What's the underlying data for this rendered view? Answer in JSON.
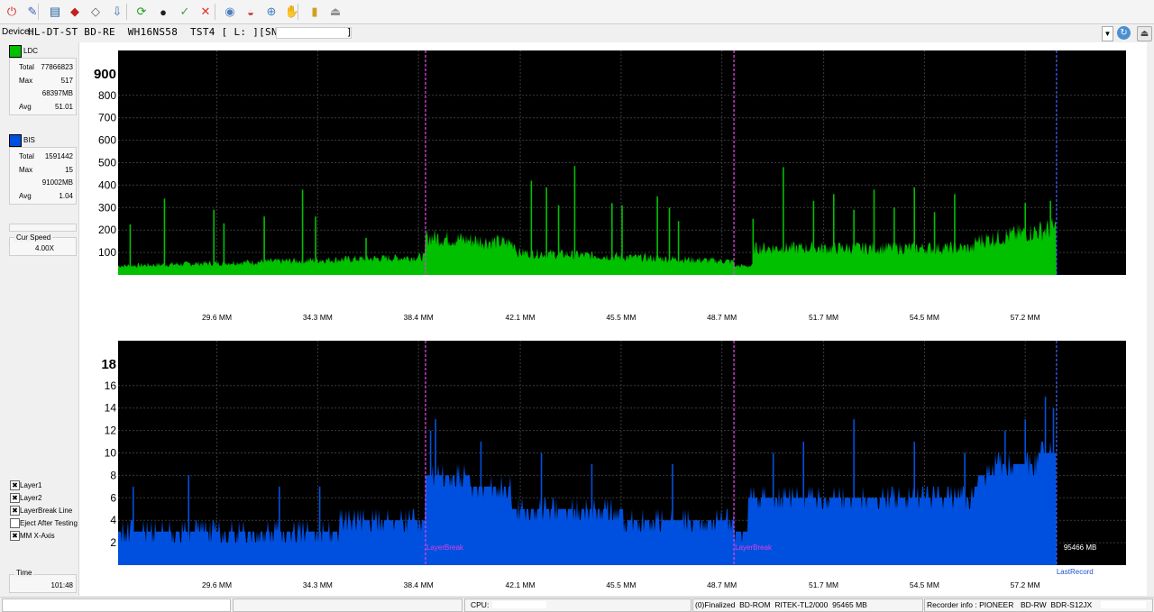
{
  "toolbar": {
    "buttons": [
      {
        "name": "power-icon",
        "glyph": "⏻",
        "color": "#d32020"
      },
      {
        "name": "disc-info-icon",
        "glyph": "✎",
        "color": "#4060c0"
      },
      {
        "name": "drive-icon",
        "glyph": "▤",
        "color": "#2060a0"
      },
      {
        "name": "erase-icon",
        "glyph": "◆",
        "color": "#c02020"
      },
      {
        "name": "burn-icon",
        "glyph": "◇",
        "color": "#606060"
      },
      {
        "name": "copy-icon",
        "glyph": "⇩",
        "color": "#4070b0"
      },
      {
        "name": "refresh-icon",
        "glyph": "⟳",
        "color": "#20a020"
      },
      {
        "name": "scan-icon",
        "glyph": "●",
        "color": "#202020"
      },
      {
        "name": "verify-icon",
        "glyph": "✓",
        "color": "#40a040"
      },
      {
        "name": "stop-icon",
        "glyph": "✕",
        "color": "#e03030"
      },
      {
        "name": "save-icon",
        "glyph": "◉",
        "color": "#5080c0"
      },
      {
        "name": "save-image-icon",
        "glyph": "◒",
        "color": "#c04040"
      },
      {
        "name": "compare-icon",
        "glyph": "⊕",
        "color": "#4080c0"
      },
      {
        "name": "settings-icon",
        "glyph": "✋",
        "color": "#e06020"
      },
      {
        "name": "chart-icon",
        "glyph": "▮",
        "color": "#d0a020"
      },
      {
        "name": "eject-icon",
        "glyph": "⏏",
        "color": "#909090"
      }
    ]
  },
  "device": {
    "label": "Device:",
    "name": "HL-DT-ST BD-RE  WH16NS58  TST4 [ L: ][SN:",
    "name_end": "]"
  },
  "ldc": {
    "label": "LDC",
    "color": "#00c000",
    "rows": [
      {
        "k": "Total",
        "v": "77866823"
      },
      {
        "k": "Max",
        "v": "517"
      },
      {
        "k": "",
        "v": "68397MB"
      },
      {
        "k": "Avg",
        "v": "51.01"
      }
    ]
  },
  "bis": {
    "label": "BIS",
    "color": "#0050e0",
    "rows": [
      {
        "k": "Total",
        "v": "1591442"
      },
      {
        "k": "Max",
        "v": "15"
      },
      {
        "k": "",
        "v": "91002MB"
      },
      {
        "k": "Avg",
        "v": "1.04"
      }
    ]
  },
  "speed": {
    "label": "Cur Speed",
    "value": "4.00X"
  },
  "options": [
    {
      "label": "Layer1",
      "checked": true
    },
    {
      "label": "Layer2",
      "checked": true
    },
    {
      "label": "LayerBreak Line",
      "checked": true
    },
    {
      "label": "Eject After Testing",
      "checked": false
    },
    {
      "label": "MM X-Axis",
      "checked": true
    }
  ],
  "time": {
    "label": "Time",
    "value": "101:48"
  },
  "chart_data": [
    {
      "type": "bar",
      "title": "",
      "series_name": "LDC",
      "color": "#00c000",
      "y_max_label": "900",
      "y_ticks": [
        "100",
        "200",
        "300",
        "400",
        "500",
        "600",
        "700",
        "800"
      ],
      "ylim": [
        0,
        1000
      ],
      "x_ticks": [
        "29.6 MM",
        "34.3 MM",
        "38.4 MM",
        "42.1 MM",
        "45.5 MM",
        "48.7 MM",
        "51.7 MM",
        "54.5 MM",
        "57.2 MM"
      ],
      "layer_breaks_fraction": [
        0.305,
        0.611
      ],
      "last_record_fraction": 0.931,
      "segments": [
        {
          "from": 0.0,
          "to": 0.305,
          "base_start": 40,
          "base_end": 80
        },
        {
          "from": 0.305,
          "to": 0.395,
          "base_start": 170,
          "base_end": 140
        },
        {
          "from": 0.395,
          "to": 0.611,
          "base_start": 100,
          "base_end": 60
        },
        {
          "from": 0.611,
          "to": 0.63,
          "base_start": 40,
          "base_end": 40
        },
        {
          "from": 0.63,
          "to": 0.85,
          "base_start": 120,
          "base_end": 120
        },
        {
          "from": 0.85,
          "to": 0.931,
          "base_start": 150,
          "base_end": 210
        }
      ],
      "spikes": [
        [
          0.012,
          225
        ],
        [
          0.046,
          340
        ],
        [
          0.095,
          290
        ],
        [
          0.105,
          230
        ],
        [
          0.145,
          260
        ],
        [
          0.183,
          380
        ],
        [
          0.196,
          260
        ],
        [
          0.246,
          165
        ],
        [
          0.41,
          420
        ],
        [
          0.425,
          390
        ],
        [
          0.437,
          310
        ],
        [
          0.453,
          485
        ],
        [
          0.49,
          320
        ],
        [
          0.5,
          310
        ],
        [
          0.535,
          350
        ],
        [
          0.547,
          300
        ],
        [
          0.556,
          240
        ],
        [
          0.63,
          250
        ],
        [
          0.66,
          480
        ],
        [
          0.69,
          330
        ],
        [
          0.71,
          360
        ],
        [
          0.73,
          290
        ],
        [
          0.75,
          380
        ],
        [
          0.77,
          300
        ],
        [
          0.79,
          390
        ],
        [
          0.81,
          280
        ],
        [
          0.83,
          360
        ],
        [
          0.9,
          320
        ],
        [
          0.925,
          330
        ]
      ]
    },
    {
      "type": "bar",
      "title": "",
      "series_name": "BIS",
      "color": "#0050e0",
      "y_max_label": "18",
      "y_ticks": [
        "2",
        "4",
        "6",
        "8",
        "10",
        "12",
        "14",
        "16"
      ],
      "ylim": [
        0,
        20
      ],
      "x_ticks": [
        "29.6 MM",
        "34.3 MM",
        "38.4 MM",
        "42.1 MM",
        "45.5 MM",
        "48.7 MM",
        "51.7 MM",
        "54.5 MM",
        "57.2 MM"
      ],
      "layer_breaks_fraction": [
        0.305,
        0.611
      ],
      "last_record_fraction": 0.931,
      "layer_break_label": "LayerBreak",
      "last_record_label": "LastRecord",
      "end_value_label": "95466 MB",
      "segments": [
        {
          "from": 0.0,
          "to": 0.22,
          "base_start": 3,
          "base_end": 3
        },
        {
          "from": 0.22,
          "to": 0.305,
          "base_start": 4,
          "base_end": 4
        },
        {
          "from": 0.305,
          "to": 0.39,
          "base_start": 8,
          "base_end": 7
        },
        {
          "from": 0.39,
          "to": 0.611,
          "base_start": 5,
          "base_end": 4
        },
        {
          "from": 0.611,
          "to": 0.625,
          "base_start": 3,
          "base_end": 3
        },
        {
          "from": 0.625,
          "to": 0.85,
          "base_start": 6,
          "base_end": 6
        },
        {
          "from": 0.85,
          "to": 0.931,
          "base_start": 8,
          "base_end": 10
        }
      ],
      "spikes": [
        [
          0.015,
          7
        ],
        [
          0.07,
          8
        ],
        [
          0.16,
          7
        ],
        [
          0.2,
          7
        ],
        [
          0.31,
          12
        ],
        [
          0.315,
          13
        ],
        [
          0.36,
          11
        ],
        [
          0.42,
          10
        ],
        [
          0.47,
          9
        ],
        [
          0.55,
          9
        ],
        [
          0.65,
          10
        ],
        [
          0.68,
          11
        ],
        [
          0.73,
          13
        ],
        [
          0.79,
          11
        ],
        [
          0.84,
          10
        ],
        [
          0.88,
          12
        ],
        [
          0.9,
          13
        ],
        [
          0.92,
          15
        ],
        [
          0.928,
          14
        ]
      ]
    }
  ],
  "status": {
    "cpu_label": "CPU:",
    "disc_info": "(0)Finalized  BD-ROM  RITEK-TL2/000  95465 MB",
    "recorder_label": "Recorder info : PIONEER",
    "recorder_model": "BD-RW  BDR-S12JX"
  }
}
